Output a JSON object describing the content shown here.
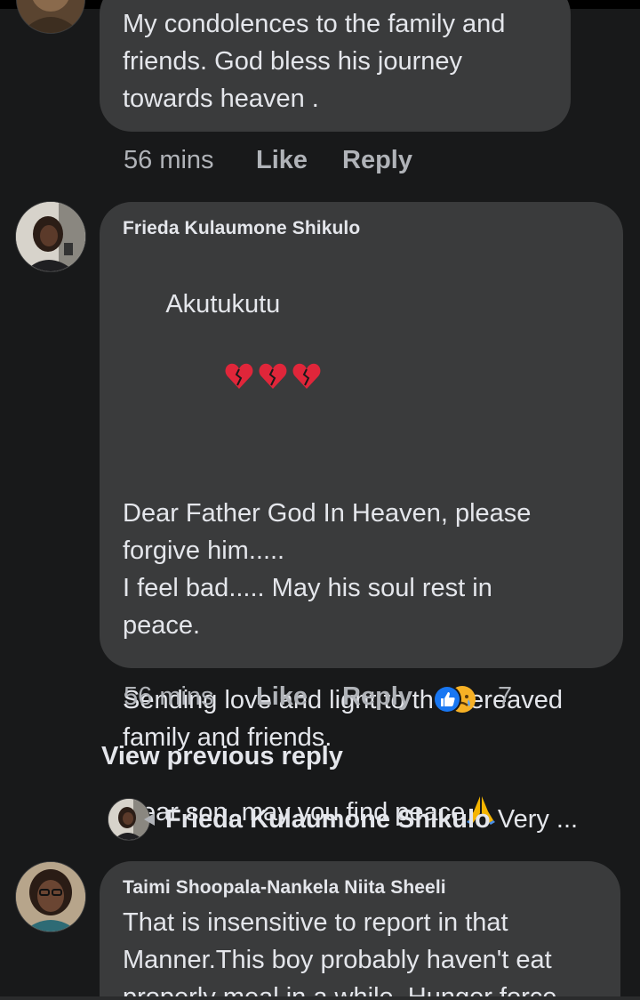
{
  "comments": [
    {
      "text": "My condolences to the family and\nfriends. God bless his journey\ntowards heaven .",
      "time": "56 mins",
      "like_label": "Like",
      "reply_label": "Reply"
    },
    {
      "author": "Frieda Kulaumone Shikulo",
      "text_line1": "Akutukutu",
      "text_rest": "Dear Father God In Heaven, please\nforgive him.....\nI feel bad..... May his soul rest in\npeace.\n\nSending love and light to the bereaved\nfamily and friends.\n\nDear son, may you find peace",
      "time": "56 mins",
      "like_label": "Like",
      "reply_label": "Reply",
      "reactions": {
        "icons": [
          "like-icon",
          "sad-icon"
        ],
        "count": "7"
      }
    },
    {
      "author": "Taimi Shoopala-Nankela Niita Sheeli",
      "text": "That is insensitive to report in that\nManner.This boy probably haven't eat\nproperly meal in a while. Hunger force"
    }
  ],
  "view_previous_reply": "View previous reply",
  "reply_preview": {
    "author": "Frieda Kulaumone Shikulo",
    "snippet": "Very ..."
  },
  "colors": {
    "background": "#18191a",
    "bubble": "#3a3b3c",
    "muted": "#b0b3b8",
    "like_blue": "#1877f2"
  }
}
